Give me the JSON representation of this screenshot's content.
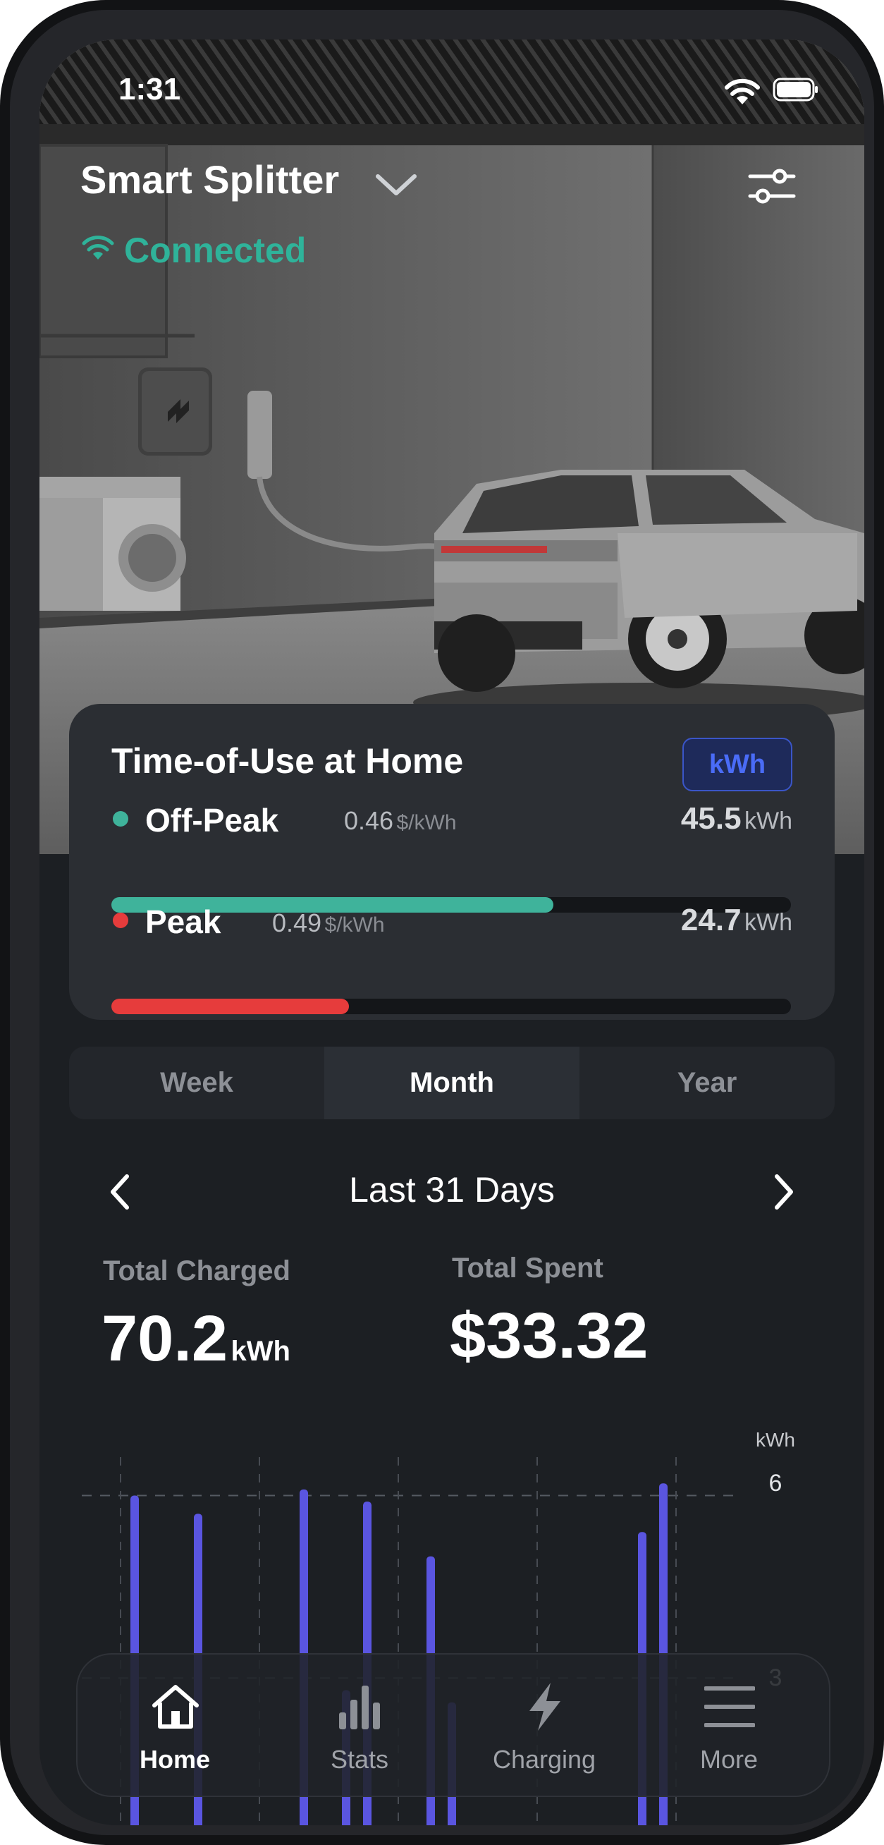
{
  "status_bar": {
    "time": "1:31"
  },
  "header": {
    "device_name": "Smart Splitter",
    "connection_status": "Connected"
  },
  "tou_card": {
    "title": "Time-of-Use at Home",
    "unit_toggle": "kWh",
    "off_peak": {
      "label": "Off-Peak",
      "rate": "0.46",
      "rate_unit": "$/kWh",
      "value": "45.5",
      "unit": "kWh",
      "fraction": 0.65
    },
    "peak": {
      "label": "Peak",
      "rate": "0.49",
      "rate_unit": "$/kWh",
      "value": "24.7",
      "unit": "kWh",
      "fraction": 0.35
    }
  },
  "tabs": [
    {
      "label": "Week"
    },
    {
      "label": "Month"
    },
    {
      "label": "Year"
    }
  ],
  "active_tab": "Month",
  "period": {
    "label": "Last 31 Days"
  },
  "totals": {
    "charged_label": "Total Charged",
    "charged_value": "70.2",
    "charged_unit": "kWh",
    "spent_label": "Total Spent",
    "spent_value": "$33.32"
  },
  "chart_data": {
    "type": "bar",
    "ylabel": "kWh",
    "yticks": [
      "6",
      "3"
    ],
    "ylim": [
      0,
      6.4
    ],
    "grid": true,
    "values": [
      null,
      0,
      6.0,
      0,
      0,
      5.7,
      0,
      0,
      0,
      0,
      6.1,
      0,
      2.8,
      5.9,
      0,
      0,
      5.0,
      2.6,
      0,
      0,
      0,
      0,
      0,
      0,
      0,
      0,
      5.4,
      6.2,
      0,
      0,
      0
    ],
    "color": "#5a55e0"
  },
  "bottom_nav": [
    {
      "label": "Home",
      "icon": "home-icon"
    },
    {
      "label": "Stats",
      "icon": "stats-icon"
    },
    {
      "label": "Charging",
      "icon": "lightning-icon"
    },
    {
      "label": "More",
      "icon": "menu-icon"
    }
  ],
  "colors": {
    "accent": "#2fb39a",
    "off_peak": "#3fb39b",
    "peak": "#e63c3c",
    "bar": "#5a55e0",
    "active_nav": "#ffffff",
    "toggle": "#4a6cf7"
  }
}
